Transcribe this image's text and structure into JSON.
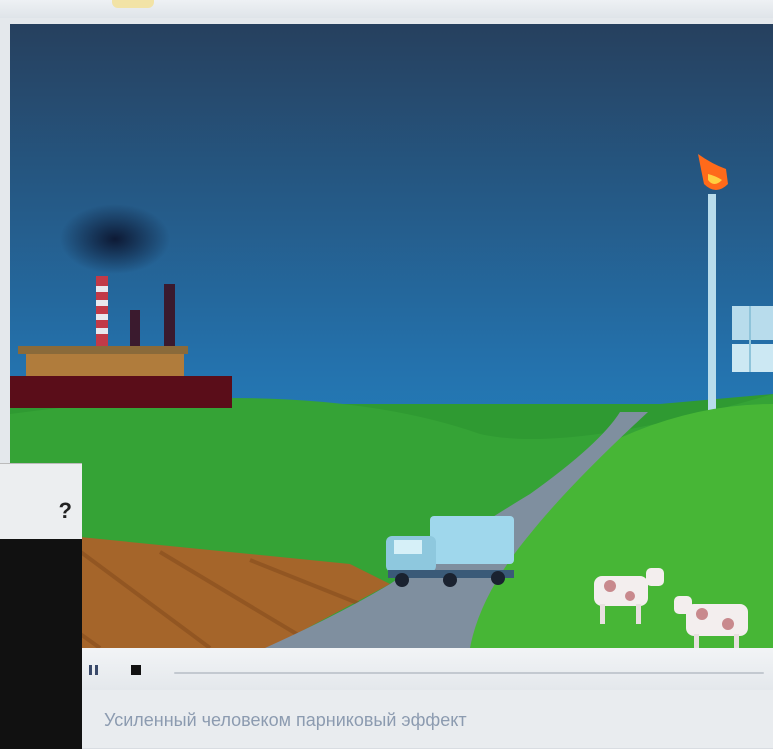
{
  "side_panel": {
    "heading_char": "?"
  },
  "controls": {
    "pause_icon": "pause-icon",
    "stop_icon": "stop-icon"
  },
  "caption": {
    "text": "Усиленный человеком парниковый эффект"
  },
  "colors": {
    "sky_top": "#25415f",
    "sky_bottom": "#1f93d6",
    "hill_green": "#3aa83a",
    "road": "#7f8f9f",
    "factory_base": "#5a0d19",
    "flare": "#ff6a1a",
    "caption_text": "#8c9bb0"
  }
}
